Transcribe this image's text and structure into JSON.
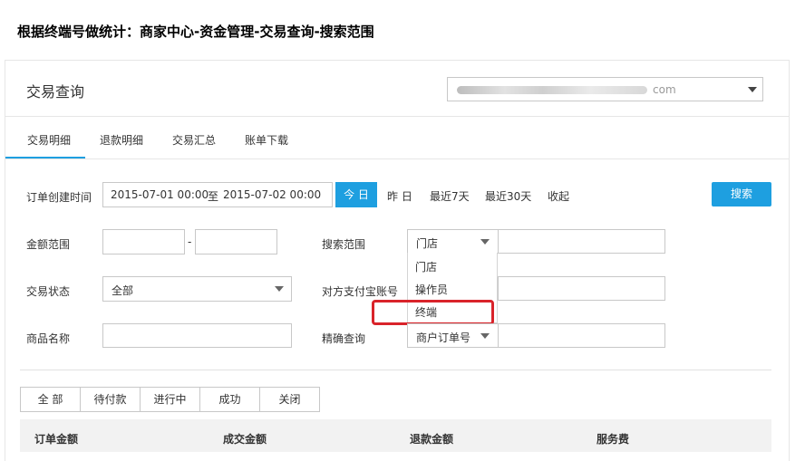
{
  "caption": "根据终端号做统计：商家中心-资金管理-交易查询-搜索范围",
  "header": {
    "title": "交易查询",
    "account_suffix": "com"
  },
  "tabs": [
    "交易明细",
    "退款明细",
    "交易汇总",
    "账单下载"
  ],
  "filters": {
    "order_time_label": "订单创建时间",
    "date_from": "2015-07-01 00:00",
    "date_sep": "至",
    "date_to": "2015-07-02 00:00",
    "today": "今 日",
    "yesterday": "昨 日",
    "last7": "最近7天",
    "last30": "最近30天",
    "collapse": "收起",
    "search_button": "搜索",
    "amount_label": "金额范围",
    "amount_sep": "-",
    "scope_label": "搜索范围",
    "scope_value": "门店",
    "status_label": "交易状态",
    "status_value": "全部",
    "counterparty_label": "对方支付宝账号",
    "product_label": "商品名称",
    "exact_label": "精确查询",
    "exact_value": "商户订单号"
  },
  "scope_dropdown": [
    "门店",
    "操作员",
    "终端"
  ],
  "status_tabs": [
    "全 部",
    "待付款",
    "进行中",
    "成功",
    "关闭"
  ],
  "table_headers": [
    "订单金额",
    "成交金额",
    "退款金额",
    "服务费"
  ],
  "colors": {
    "accent": "#1e9fe0",
    "highlight": "#d9232a"
  }
}
